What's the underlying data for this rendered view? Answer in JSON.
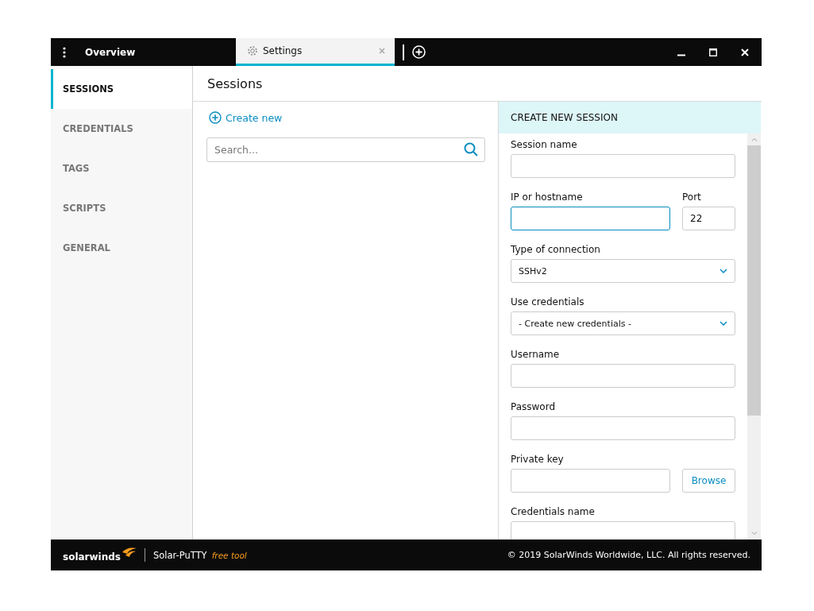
{
  "titlebar": {
    "tabs": [
      {
        "label": "Overview",
        "selected": false
      },
      {
        "label": "Settings",
        "selected": true
      }
    ]
  },
  "sidebar": {
    "items": [
      {
        "label": "SESSIONS",
        "selected": true
      },
      {
        "label": "CREDENTIALS",
        "selected": false
      },
      {
        "label": "TAGS",
        "selected": false
      },
      {
        "label": "SCRIPTS",
        "selected": false
      },
      {
        "label": "GENERAL",
        "selected": false
      }
    ]
  },
  "page_title": "Sessions",
  "sessions": {
    "create_link": "Create new",
    "search": {
      "placeholder": "Search..."
    }
  },
  "panel": {
    "title": "CREATE NEW SESSION",
    "rows": [
      {
        "fields": [
          {
            "label": "Session name",
            "kind": "text",
            "focused": false
          }
        ]
      },
      {
        "fields": [
          {
            "label": "IP or hostname",
            "kind": "text",
            "focused": true
          },
          {
            "label": "Port",
            "kind": "text",
            "value": "22",
            "focused": false
          }
        ]
      },
      {
        "fields": [
          {
            "label": "Type of connection",
            "kind": "select",
            "value": "SSHv2",
            "focused": false
          }
        ]
      },
      {
        "fields": [
          {
            "label": "Use credentials",
            "kind": "select",
            "value": "- Create new credentials -",
            "focused": false
          }
        ]
      },
      {
        "fields": [
          {
            "label": "Username",
            "kind": "text",
            "focused": false
          }
        ]
      },
      {
        "fields": [
          {
            "label": "Password",
            "kind": "text",
            "focused": false
          }
        ]
      },
      {
        "fields": [
          {
            "label": "Private key",
            "kind": "text",
            "focused": false
          }
        ],
        "button": "Browse"
      },
      {
        "fields": [
          {
            "label": "Credentials name",
            "kind": "text",
            "focused": false
          }
        ]
      }
    ]
  },
  "footer": {
    "brand": "solarwinds",
    "product": "Solar-PuTTY",
    "tagline": "free tool",
    "copyright": "© 2019 SolarWinds Worldwide, LLC. All rights reserved."
  }
}
